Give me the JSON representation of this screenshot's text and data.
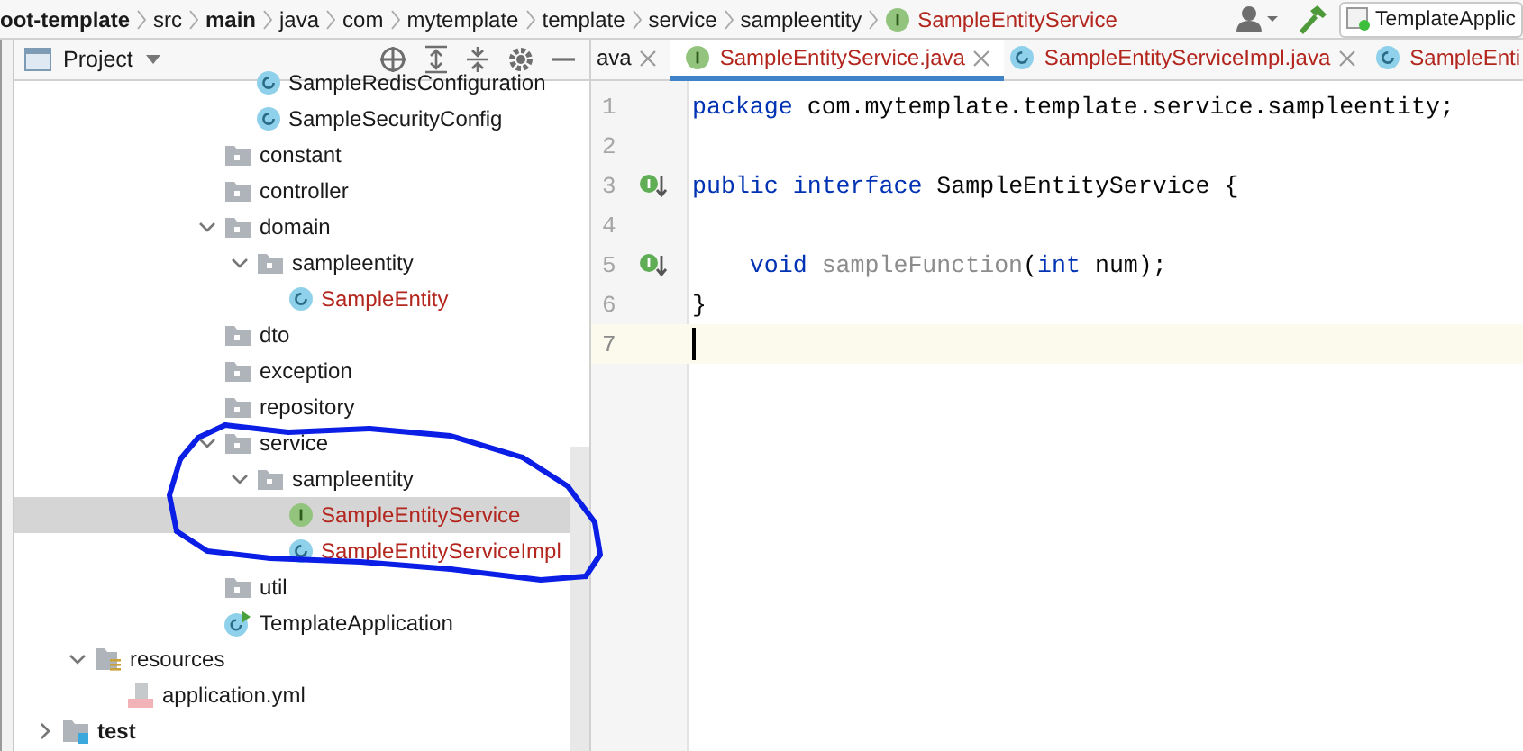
{
  "breadcrumbs": [
    {
      "label": "oot-template",
      "bold": true,
      "unversioned": false
    },
    {
      "label": "src",
      "bold": false,
      "unversioned": false
    },
    {
      "label": "main",
      "bold": true,
      "unversioned": false
    },
    {
      "label": "java",
      "bold": false,
      "unversioned": false
    },
    {
      "label": "com",
      "bold": false,
      "unversioned": false
    },
    {
      "label": "mytemplate",
      "bold": false,
      "unversioned": false
    },
    {
      "label": "template",
      "bold": false,
      "unversioned": false
    },
    {
      "label": "service",
      "bold": false,
      "unversioned": false
    },
    {
      "label": "sampleentity",
      "bold": false,
      "unversioned": false
    },
    {
      "label": "SampleEntityService",
      "bold": false,
      "unversioned": true
    }
  ],
  "run_configuration": {
    "label": "TemplateApplic"
  },
  "project_panel": {
    "title": "Project"
  },
  "tree_sections": [
    {
      "items": [
        {
          "label": "SampleRedisConfiguration",
          "kind": "class",
          "selected": false,
          "unversioned": false
        },
        {
          "label": "SampleSecurityConfig",
          "kind": "class",
          "selected": false,
          "unversioned": false
        }
      ]
    },
    {
      "items": [
        {
          "label": "constant",
          "kind": "package",
          "selected": false,
          "unversioned": false
        },
        {
          "label": "controller",
          "kind": "package",
          "selected": false,
          "unversioned": false
        },
        {
          "label": "domain",
          "kind": "package",
          "selected": false,
          "unversioned": false,
          "expanded": true,
          "children": [
            {
              "label": "sampleentity",
              "kind": "package",
              "selected": false,
              "unversioned": false,
              "expanded": true,
              "children": [
                {
                  "label": "SampleEntity",
                  "kind": "class",
                  "selected": false,
                  "unversioned": true
                }
              ]
            }
          ]
        },
        {
          "label": "dto",
          "kind": "package",
          "selected": false,
          "unversioned": false
        },
        {
          "label": "exception",
          "kind": "package",
          "selected": false,
          "unversioned": false
        },
        {
          "label": "repository",
          "kind": "package",
          "selected": false,
          "unversioned": false
        },
        {
          "label": "service",
          "kind": "package",
          "selected": false,
          "unversioned": false,
          "expanded": true,
          "children": [
            {
              "label": "sampleentity",
              "kind": "package",
              "selected": false,
              "unversioned": false,
              "expanded": true,
              "children": [
                {
                  "label": "SampleEntityService",
                  "kind": "interface",
                  "selected": true,
                  "unversioned": true
                },
                {
                  "label": "SampleEntityServiceImpl",
                  "kind": "class",
                  "selected": false,
                  "unversioned": true
                }
              ]
            }
          ]
        },
        {
          "label": "util",
          "kind": "package",
          "selected": false,
          "unversioned": false
        },
        {
          "label": "TemplateApplication",
          "kind": "spring-class",
          "selected": false,
          "unversioned": false
        }
      ]
    },
    {
      "items": [
        {
          "label": "resources",
          "kind": "resources",
          "selected": false,
          "unversioned": false,
          "expanded": true,
          "children": [
            {
              "label": "application.yml",
              "kind": "yml",
              "selected": false,
              "unversioned": false
            }
          ]
        }
      ]
    },
    {
      "items": [
        {
          "label": "test",
          "kind": "module",
          "selected": false,
          "unversioned": false,
          "expanded": false
        }
      ]
    }
  ],
  "editor_tabs": [
    {
      "label": "ava",
      "kind": "partial",
      "selected": false,
      "unversioned": false,
      "closable": true
    },
    {
      "label": "SampleEntityService.java",
      "kind": "interface",
      "selected": true,
      "unversioned": true,
      "closable": true
    },
    {
      "label": "SampleEntityServiceImpl.java",
      "kind": "class",
      "selected": false,
      "unversioned": true,
      "closable": true
    },
    {
      "label": "SampleEnti",
      "kind": "class",
      "selected": false,
      "unversioned": true,
      "closable": false
    }
  ],
  "code_lines": [
    {
      "number": "1",
      "gutter_marker": false,
      "current": false,
      "tokens": [
        {
          "kind": "keyword",
          "text": "package"
        },
        {
          "kind": "plain",
          "text": " com.mytemplate.template.service.sampleentity;"
        }
      ]
    },
    {
      "number": "2",
      "gutter_marker": false,
      "current": false
    },
    {
      "number": "3",
      "gutter_marker": true,
      "current": false,
      "tokens": [
        {
          "kind": "keyword",
          "text": "public"
        },
        {
          "kind": "keyword",
          "text": " interface"
        },
        {
          "kind": "plain",
          "text": " SampleEntityService {"
        }
      ]
    },
    {
      "number": "4",
      "gutter_marker": false,
      "current": false
    },
    {
      "number": "5",
      "gutter_marker": true,
      "current": false,
      "tokens": [
        {
          "kind": "keyword",
          "text": "    void"
        },
        {
          "kind": "unused",
          "text": " sampleFunction"
        },
        {
          "kind": "plain",
          "text": "("
        },
        {
          "kind": "keyword",
          "text": "int"
        },
        {
          "kind": "plain",
          "text": " num);"
        }
      ]
    },
    {
      "number": "6",
      "gutter_marker": false,
      "current": false,
      "tokens": [
        {
          "kind": "plain",
          "text": "}"
        }
      ]
    },
    {
      "number": "7",
      "gutter_marker": false,
      "current": true
    }
  ]
}
